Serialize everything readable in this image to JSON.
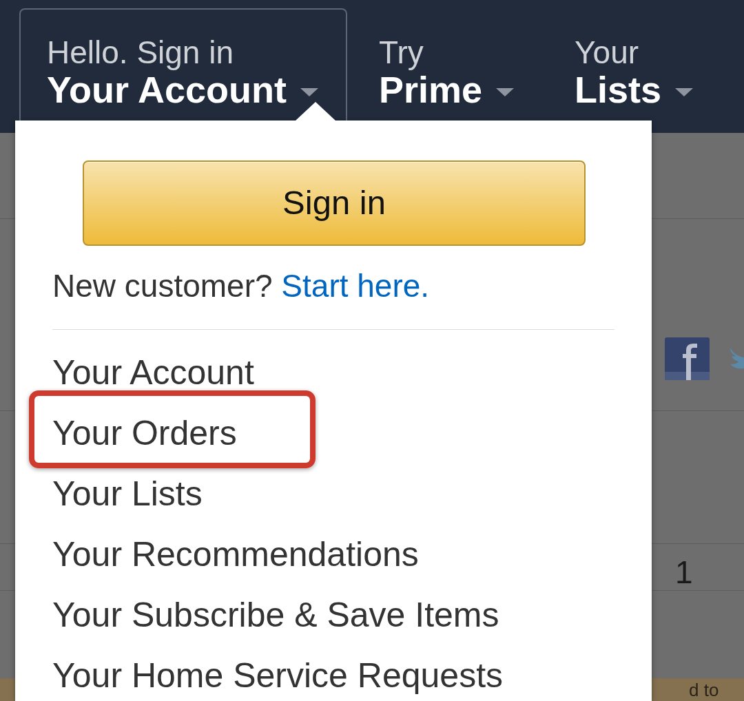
{
  "nav_items": [
    {
      "top": "Hello. Sign in",
      "bottom": "Your Account",
      "expanded": true
    },
    {
      "top": "Try",
      "bottom": "Prime",
      "expanded": false
    },
    {
      "top": "Your",
      "bottom": "Lists",
      "expanded": false
    }
  ],
  "dropdown": {
    "sign_in_button": "Sign in",
    "new_customer": {
      "text": "New customer?",
      "link": "Start here."
    },
    "menu_items": [
      {
        "label": "Your Account",
        "highlighted": false
      },
      {
        "label": "Your Orders",
        "highlighted": true
      },
      {
        "label": "Your Lists",
        "highlighted": false
      },
      {
        "label": "Your Recommendations",
        "highlighted": false
      },
      {
        "label": "Your Subscribe & Save Items",
        "highlighted": false
      },
      {
        "label": "Your Home Service Requests",
        "highlighted": false
      }
    ]
  },
  "background_page": {
    "quantity": "1",
    "banner_text": "d to"
  }
}
